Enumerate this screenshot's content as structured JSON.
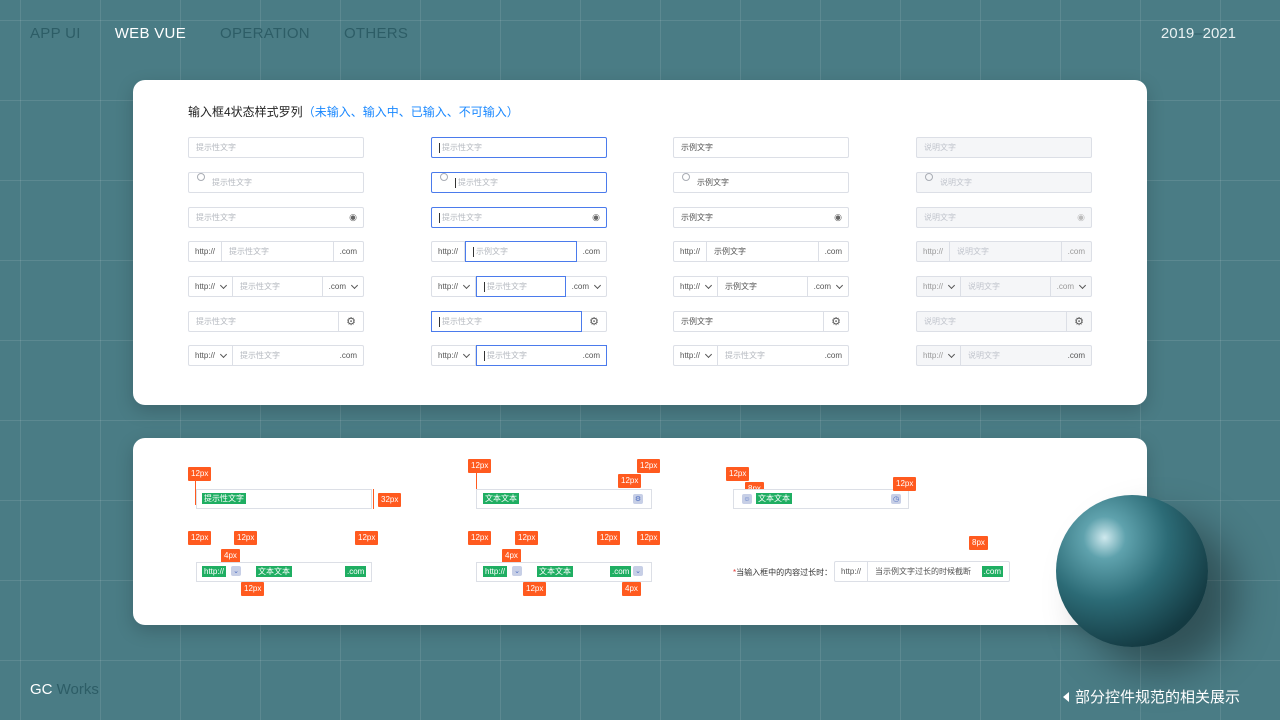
{
  "nav": {
    "items": [
      "APP UI",
      "WEB VUE",
      "OPERATION",
      "OTHERS"
    ],
    "active": "WEB VUE"
  },
  "year": {
    "start": "2019",
    "sep": "–",
    "end": "2021"
  },
  "brand": {
    "a": "GC",
    "b": "Works"
  },
  "footer_note": "部分控件规范的相关展示",
  "card1": {
    "title": "输入框4状态样式罗列",
    "title_highlight": "（未输入、输入中、已输入、不可输入）",
    "placeholder": "提示性文字",
    "example": "示例文字",
    "disabled_text": "说明文字",
    "prefix": "http://",
    "suffix": ".com"
  },
  "card2": {
    "tags": {
      "px12": "12px",
      "px32": "32px",
      "px8": "8px",
      "px4": "4px"
    },
    "placeholder": "提示性文字",
    "text": "文本文本",
    "prefix": "http://",
    "suffix": ".com",
    "long_label": "当输入框中的内容过长时：",
    "long_required": "*",
    "long_prefix": "http://",
    "long_text": "当示例文字过长的时候截断",
    "long_suffix": ".com"
  },
  "colors": {
    "background": "#4a7c85",
    "accent_blue": "#1a88ff",
    "focus_border": "#4b7bec",
    "annotation_orange": "#ff5a1f",
    "annotation_green": "#1fae62"
  }
}
